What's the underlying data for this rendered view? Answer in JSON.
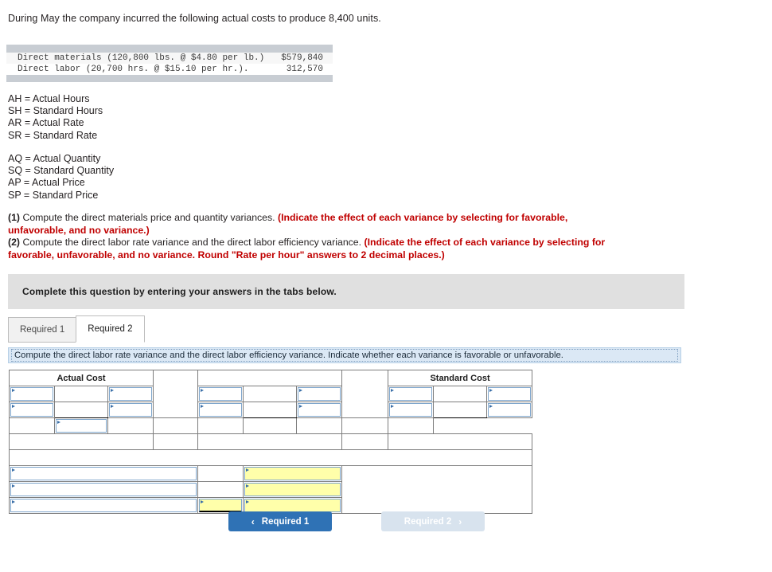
{
  "intro": "During May the company incurred the following actual costs to produce 8,400 units.",
  "cost_table": {
    "rows": [
      {
        "label": "Direct materials (120,800 lbs. @ $4.80 per lb.)",
        "amount": "$579,840"
      },
      {
        "label": "Direct labor (20,700 hrs. @ $15.10 per hr.).",
        "amount": "312,570"
      }
    ]
  },
  "legend_group_1": [
    "AH = Actual Hours",
    "SH = Standard Hours",
    "AR = Actual Rate",
    "SR = Standard Rate"
  ],
  "legend_group_2": [
    "AQ = Actual Quantity",
    "SQ = Standard Quantity",
    "AP = Actual Price",
    "SP = Standard Price"
  ],
  "requirements": {
    "r1_num": "(1)",
    "r1_plain": " Compute the direct materials price and quantity variances. ",
    "r1_bold": "(Indicate the effect of each variance by selecting for favorable, unfavorable, and no variance.)",
    "r2_num": "(2)",
    "r2_plain": " Compute the direct labor rate variance and the direct labor efficiency variance. ",
    "r2_bold": "(Indicate the effect of each variance by selecting for favorable, unfavorable, and no variance. Round \"Rate per hour\" answers to 2 decimal places.)"
  },
  "banner_text": "Complete this question by entering your answers in the tabs below.",
  "tabs": [
    {
      "label": "Required 1",
      "active": false
    },
    {
      "label": "Required 2",
      "active": true
    }
  ],
  "tab_instruction": "Compute the direct labor rate variance and the direct labor efficiency variance. Indicate whether each variance is favorable or unfavorable.",
  "grid": {
    "header_actual_cost": "Actual Cost",
    "header_middle": "",
    "header_standard_cost": "Standard Cost",
    "cells_empty": ""
  },
  "nav": {
    "prev_label": "Required 1",
    "prev_chevron": "‹",
    "next_label": "Required 2",
    "next_chevron": "›"
  },
  "colors": {
    "header_blue": "#7eafe2",
    "input_yellow": "#ffffaa",
    "instruction_red": "#c00000",
    "banner_gray": "#e0e0e0",
    "primary_button": "#2f72b5",
    "disabled_button": "#d8e3ee"
  }
}
